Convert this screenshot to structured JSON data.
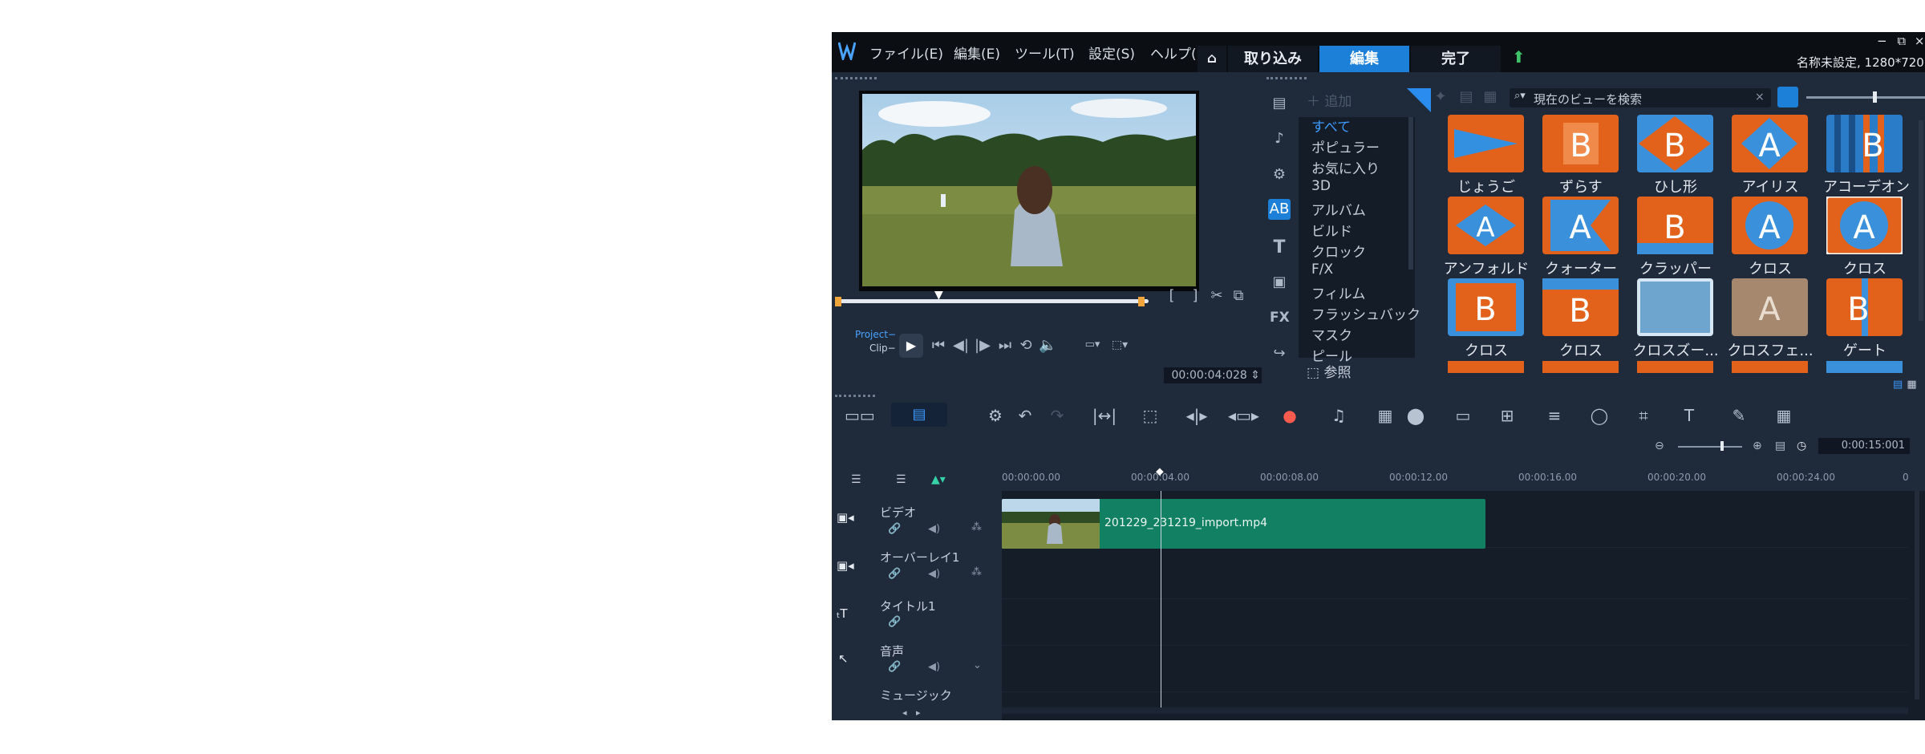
{
  "menu": [
    "ファイル(E)",
    "編集(E)",
    "ツール(T)",
    "設定(S)",
    "ヘルプ(I"
  ],
  "steps": {
    "home_icon": "home-icon",
    "capture": "取り込み",
    "edit": "編集",
    "share": "完了"
  },
  "window": {
    "minimize": "−",
    "restore": "⧉",
    "close": "×",
    "project_info": "名称未設定, 1280*720"
  },
  "player": {
    "project_label": "Project−",
    "clip_label": "Clip−",
    "timecode": "00:00:04:028",
    "mark_in": "[",
    "mark_out": "]"
  },
  "library": {
    "add_label": "追加",
    "search_placeholder": "現在のビューを検索",
    "browse_label": "参照",
    "categories": [
      "すべて",
      "ポピュラー",
      "お気に入り",
      "3D",
      "アルバム",
      "ビルド",
      "クロック",
      "F/X",
      "フィルム",
      "フラッシュバック",
      "マスク",
      "ピール"
    ],
    "thumbnails": [
      {
        "label": "じょうご",
        "letter": "",
        "bg": "#e2621c"
      },
      {
        "label": "ずらす",
        "letter": "B",
        "bg": "#e2621c"
      },
      {
        "label": "ひし形",
        "letter": "B",
        "bg": "#e2621c"
      },
      {
        "label": "アイリス",
        "letter": "A",
        "bg": "#e2621c"
      },
      {
        "label": "アコーデオン",
        "letter": "B",
        "bg": "#2a7cc9"
      },
      {
        "label": "アンフォルド",
        "letter": "A",
        "bg": "#e2621c"
      },
      {
        "label": "クォーター",
        "letter": "A",
        "bg": "#e2621c"
      },
      {
        "label": "クラッパー",
        "letter": "B",
        "bg": "#e2621c"
      },
      {
        "label": "クロス",
        "letter": "A",
        "bg": "#e2621c"
      },
      {
        "label": "クロス",
        "letter": "A",
        "bg": "#e2621c"
      },
      {
        "label": "クロス",
        "letter": "B",
        "bg": "#e2621c"
      },
      {
        "label": "クロス",
        "letter": "B",
        "bg": "#e2621c"
      },
      {
        "label": "クロスズー...",
        "letter": "",
        "bg": "#6ea5cf"
      },
      {
        "label": "クロスフェ...",
        "letter": "A",
        "bg": "#a6886f"
      },
      {
        "label": "ゲート",
        "letter": "B",
        "bg": "#e2621c"
      }
    ]
  },
  "timeline": {
    "zoom_duration": "0:00:15:001",
    "ticks": [
      "00:00:00.00",
      "00:00:04.00",
      "00:00:08.00",
      "00:00:12.00",
      "00:00:16.00",
      "00:00:20.00",
      "00:00:24.00",
      "0"
    ],
    "tracks": [
      {
        "name": "ビデオ"
      },
      {
        "name": "オーバーレイ1"
      },
      {
        "name": "タイトル1"
      },
      {
        "name": "音声"
      },
      {
        "name": "ミュージック"
      }
    ],
    "clip": {
      "name": "201229_231219_import.mp4",
      "color": "#128063"
    }
  }
}
